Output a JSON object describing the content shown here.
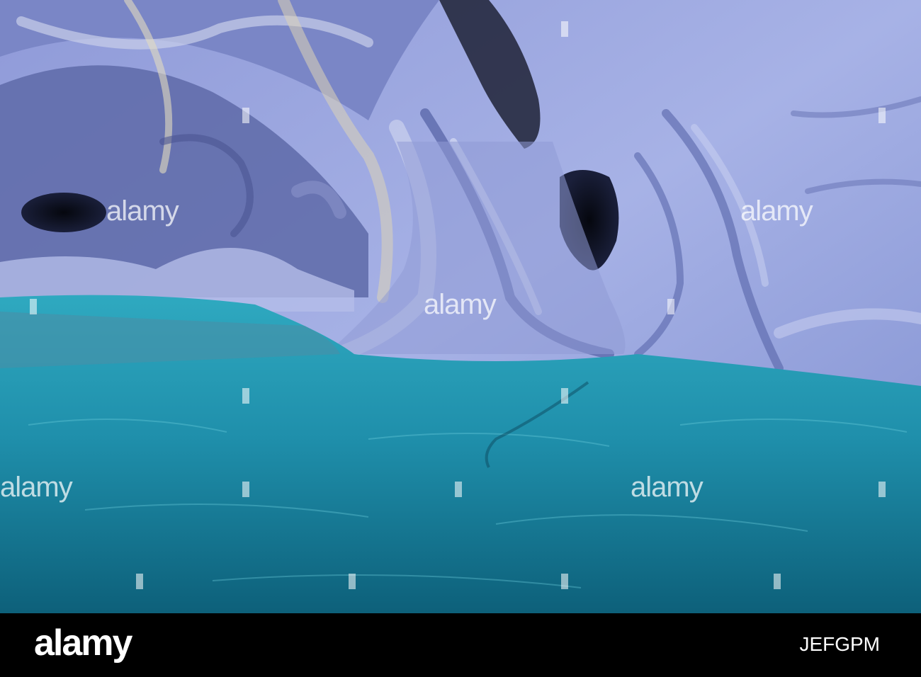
{
  "photo": {
    "watermark_text": "alamy",
    "palette": {
      "rock_light": "#a9b4e6",
      "rock_mid": "#6e7fc6",
      "rock_dark": "#3b4580",
      "water_top": "#2a9fb7",
      "water_deep": "#0d5e78",
      "hole": "#0b0d18"
    }
  },
  "footer": {
    "logo": "alamy",
    "image_id": "JEFGPM"
  }
}
